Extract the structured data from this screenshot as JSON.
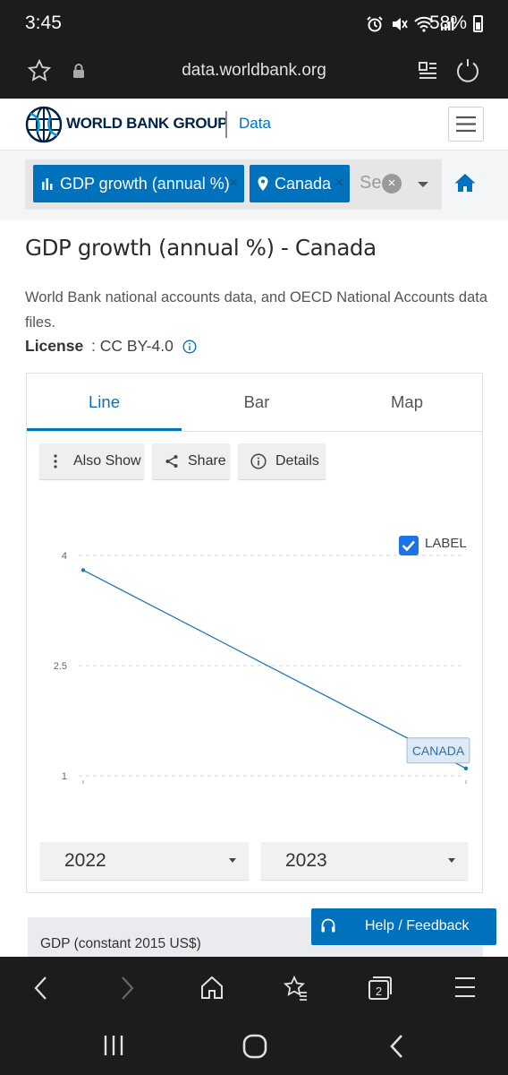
{
  "status_bar": {
    "time": "3:45",
    "battery": "58%"
  },
  "browser": {
    "url": "data.worldbank.org",
    "tab_count": "2"
  },
  "site": {
    "logo_text": "WORLD BANK GROUP",
    "section": "Data"
  },
  "filters": {
    "indicator_chip": "GDP growth (annual %)",
    "country_chip": "Canada",
    "search_placeholder": "Se",
    "chip_remove": "×",
    "clear": "×"
  },
  "page": {
    "title": "GDP growth (annual %) - Canada",
    "source": "World Bank national accounts data, and OECD National Accounts data files.",
    "license_label": "License",
    "license_sep": " : ",
    "license_value": "CC BY-4.0"
  },
  "tabs": [
    {
      "label": "Line",
      "active": true
    },
    {
      "label": "Bar",
      "active": false
    },
    {
      "label": "Map",
      "active": false
    }
  ],
  "actions": {
    "also_show": "Also Show",
    "share": "Share",
    "details": "Details"
  },
  "chart_controls": {
    "label_toggle": "LABEL",
    "label_checked": true
  },
  "chart_data": {
    "type": "line",
    "x": [
      2022,
      2023
    ],
    "series": [
      {
        "name": "CANADA",
        "values": [
          3.8,
          1.1
        ],
        "color": "#1f77b4"
      }
    ],
    "ylim": [
      1,
      4
    ],
    "yticks": [
      "4",
      "2.5",
      "1"
    ],
    "grid": true,
    "xlabel": "",
    "ylabel": ""
  },
  "range": {
    "start_year": "2022",
    "end_year": "2023"
  },
  "next_section": {
    "title": "GDP (constant 2015 US$)"
  },
  "help": {
    "label": "Help / Feedback"
  },
  "colors": {
    "accent": "#0071bc",
    "brand_dark": "#002244",
    "dark_chrome": "#1c1c1e"
  }
}
